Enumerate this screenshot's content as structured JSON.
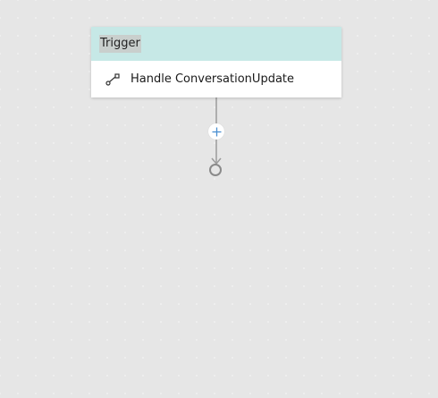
{
  "trigger": {
    "title": "Trigger",
    "event_label": "Handle ConversationUpdate",
    "event_icon": "flow-branch-icon"
  },
  "flow": {
    "add_icon": "plus-icon",
    "end_icon": "end-circle-icon"
  },
  "colors": {
    "canvas": "#e6e6e6",
    "header": "#c6e8e6",
    "connector": "#9b9b9b",
    "add_accent": "#4a8fd1"
  }
}
